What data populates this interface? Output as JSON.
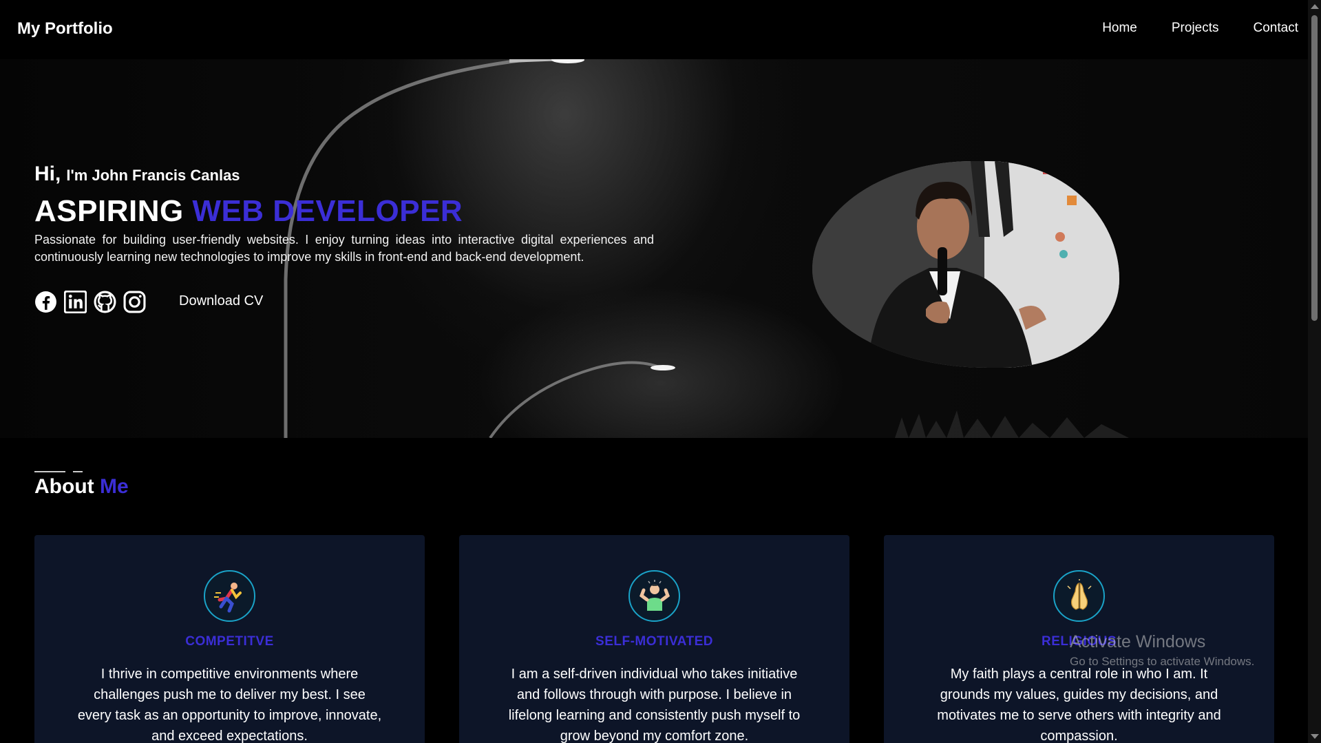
{
  "nav": {
    "brand": "My Portfolio",
    "links": [
      "Home",
      "Projects",
      "Contact"
    ]
  },
  "hero": {
    "hi": "Hi,",
    "name": "I'm John Francis Canlas",
    "headline_plain": "ASPIRING ",
    "headline_accent": "WEB DEVELOPER",
    "description": "Passionate for building user-friendly websites. I enjoy turning ideas into interactive digital experiences and continuously learning new technologies to improve my skills in front-end and back-end development.",
    "socials": [
      "facebook-icon",
      "linkedin-icon",
      "github-icon",
      "instagram-icon"
    ],
    "cv_label": "Download CV"
  },
  "about": {
    "title_plain": "About ",
    "title_accent": "Me",
    "cards": [
      {
        "icon": "running-person-icon",
        "title": "COMPETITVE",
        "text": "I thrive in competitive environments where challenges push me to deliver my best. I see every task as an opportunity to improve, innovate, and exceed expectations."
      },
      {
        "icon": "flexing-person-icon",
        "title": "SELF-MOTIVATED",
        "text": "I am a self-driven individual who takes initiative and follows through with purpose. I believe in lifelong learning and consistently push myself to grow beyond my comfort zone."
      },
      {
        "icon": "praying-hands-icon",
        "title": "RELIGIOUS",
        "text": "My faith plays a central role in who I am. It grounds my values, guides my decisions, and motivates me to serve others with integrity and compassion."
      }
    ]
  },
  "watermark": {
    "title": "Activate Windows",
    "subtitle": "Go to Settings to activate Windows."
  },
  "colors": {
    "accent": "#3b2ed6",
    "card_bg": "#0d1528",
    "icon_ring": "#1aa3c8"
  }
}
